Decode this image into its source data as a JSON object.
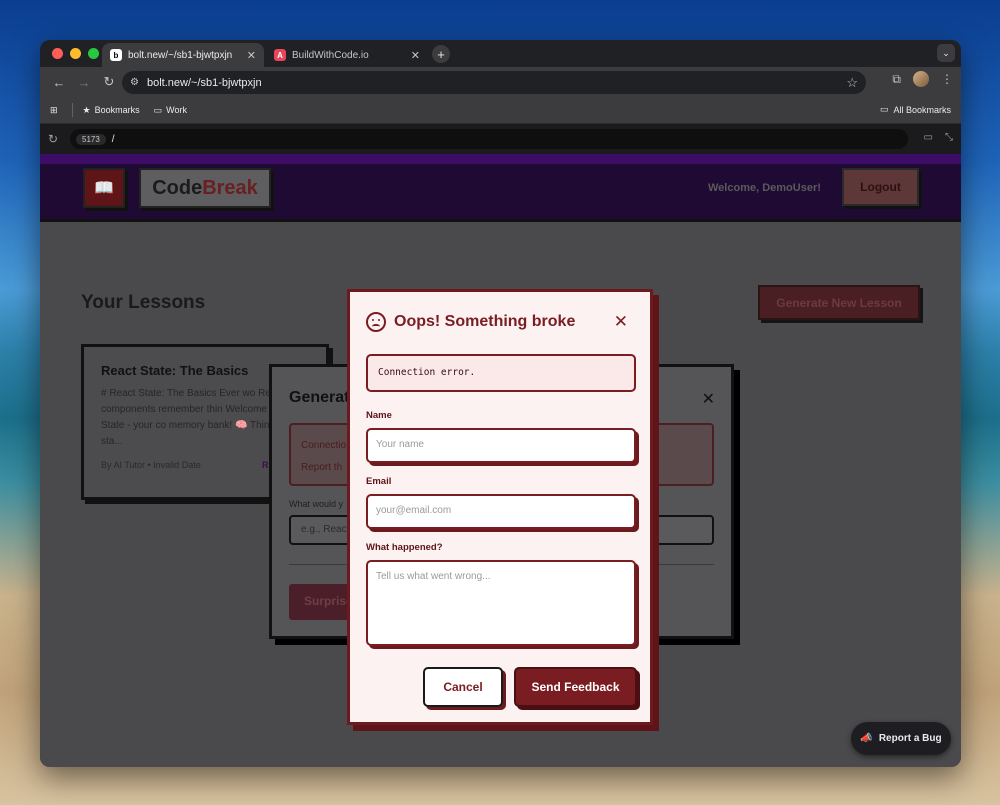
{
  "browser": {
    "tabs": [
      {
        "label": "bolt.new/~/sb1-bjwtpxjn",
        "favicon": "b"
      },
      {
        "label": "BuildWithCode.io",
        "favicon": "A"
      }
    ],
    "new_tab": "+",
    "tab_menu": "⌄",
    "address": {
      "site_icon": "⚙",
      "url": "bolt.new/~/sb1-bjwtpxjn"
    },
    "bookmarks": {
      "bookmarks_label": "Bookmarks",
      "work_label": "Work",
      "all_label": "All Bookmarks"
    },
    "devbar": {
      "port": "5173",
      "path": "/"
    }
  },
  "app": {
    "brand_part1": "Code",
    "brand_part2": "Break",
    "welcome": "Welcome, DemoUser!",
    "logout": "Logout",
    "lessons_title": "Your Lessons",
    "generate_button": "Generate New Lesson",
    "lesson_card": {
      "title": "React State: The Basics",
      "description": "# React State: The Basics Ever wo React components remember thin Welcome to React State - your co memory bank! 🧠 Think of sta...",
      "meta": "By AI Tutor • Invalid Date",
      "link_partial": "R"
    },
    "generate_modal": {
      "title_partial": "Generat",
      "error_line1": "Connectio",
      "error_line2": "Report th",
      "question_partial": "What would y",
      "input_placeholder_partial": "e.g., React",
      "surprise_partial": "Surprise"
    },
    "report_bug": "Report a Bug"
  },
  "feedback_modal": {
    "title": "Oops! Something broke",
    "error_text": "Connection error.",
    "name_label": "Name",
    "name_placeholder": "Your name",
    "email_label": "Email",
    "email_placeholder": "your@email.com",
    "what_label": "What happened?",
    "what_placeholder": "Tell us what went wrong...",
    "cancel": "Cancel",
    "send": "Send Feedback"
  },
  "colors": {
    "accent_red": "#7a1d22",
    "modal_bg": "#fdf2f2",
    "header_purple": "#1f0a33"
  }
}
